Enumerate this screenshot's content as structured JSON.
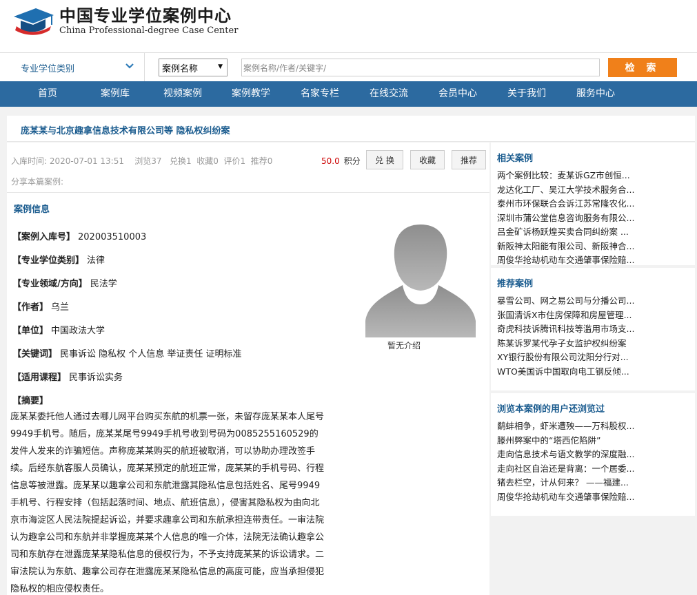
{
  "header": {
    "title_cn": "中国专业学位案例中心",
    "title_en": "China Professional-degree Case Center"
  },
  "search": {
    "category_label": "专业学位类别",
    "type_value": "案例名称",
    "placeholder": "案例名称/作者/关键字/",
    "button": "检 索"
  },
  "nav": [
    "首页",
    "案例库",
    "视频案例",
    "案例教学",
    "名家专栏",
    "在线交流",
    "会员中心",
    "关于我们",
    "服务中心"
  ],
  "case": {
    "title": "庞某某与北京趣拿信息技术有限公司等 隐私权纠纷案",
    "meta": "入库时间: 2020-07-01 13:51    浏览37   兑换1  收藏0  评价1  推荐0",
    "share": "分享本篇案例:",
    "points_value": "50.0",
    "points_unit": "积分",
    "btn_exchange": "兑 换",
    "btn_favorite": "收藏",
    "btn_recommend": "推荐",
    "section_title": "案例信息",
    "fields": [
      {
        "k": "【案例入库号】",
        "v": "202003510003"
      },
      {
        "k": "【专业学位类别】",
        "v": "法律"
      },
      {
        "k": "【专业领域/方向】",
        "v": "民法学"
      },
      {
        "k": "【作者】",
        "v": "乌兰"
      },
      {
        "k": "【单位】",
        "v": "中国政法大学"
      },
      {
        "k": "【关键词】",
        "v": "民事诉讼 隐私权 个人信息 举证责任 证明标准"
      },
      {
        "k": "【适用课程】",
        "v": "民事诉讼实务"
      }
    ],
    "avatar_caption": "暂无介绍",
    "abstract_title": "【摘要】",
    "abstract": "庞某某委托他人通过去哪儿网平台购买东航的机票一张，未留存庞某某本人尾号9949手机号。随后，庞某某尾号9949手机号收到号码为0085255160529的发件人发来的诈骗短信。声称庞某某购买的航班被取消，可以协助办理改签手续。后经东航客服人员确认，庞某某预定的航班正常，庞某某的手机号码、行程信息等被泄露。庞某某以趣拿公司和东航泄露其隐私信息包括姓名、尾号9949手机号、行程安排（包括起落时间、地点、航班信息），侵害其隐私权为由向北京市海淀区人民法院提起诉讼，并要求趣拿公司和东航承担连带责任。一审法院认为趣拿公司和东航并非掌握庞某某个人信息的唯一介体，法院无法确认趣拿公司和东航存在泄露庞某某隐私信息的侵权行为，不予支持庞某某的诉讼请求。二审法院认为东航、趣拿公司存在泄露庞某某隐私信息的高度可能，应当承担侵犯隐私权的相应侵权责任。"
  },
  "sidebar": {
    "related": {
      "title": "相关案例",
      "items": [
        "两个案例比较：麦某诉GZ市创恒...",
        "龙达化工厂、吴江大学技术服务合...",
        "泰州市环保联合会诉江苏常隆农化...",
        "深圳市蒲公堂信息咨询服务有限公...",
        "吕金矿诉杨跃煌买卖合同纠纷案 ...",
        "新阪神太阳能有限公司、新阪神合...",
        "周俊华抢劫机动车交通肇事保险赔..."
      ]
    },
    "recommended": {
      "title": "推荐案例",
      "items": [
        "暴雪公司、网之易公司与分播公司...",
        "张国清诉X市住房保障和房屋管理...",
        "奇虎科技诉腾讯科技等滥用市场支...",
        "陈某诉罗某代孕子女监护权纠纷案",
        "XY银行股份有限公司沈阳分行对...",
        "WTO美国诉中国取向电工钢反倾..."
      ]
    },
    "also_viewed": {
      "title": "浏览本案例的用户还浏览过",
      "items": [
        "鹬蚌相争，虾米遭殃——万科股权...",
        "滕州弊案中的“塔西佗陷阱”",
        "走向信息技术与语文教学的深度融...",
        "走向社区自治还是背离：一个居委...",
        "猪去栏空，计从何来？ ——福建...",
        "周俊华抢劫机动车交通肇事保险赔..."
      ]
    }
  },
  "colors": {
    "brand_blue": "#2c6aa0",
    "link_blue": "#1b5c8f",
    "accent_orange": "#f0801a",
    "points_red": "#cc0000"
  },
  "icons": {
    "logo": "graduation-cap-icon",
    "dropdown": "chevron-down-icon",
    "avatar": "person-placeholder-icon"
  }
}
